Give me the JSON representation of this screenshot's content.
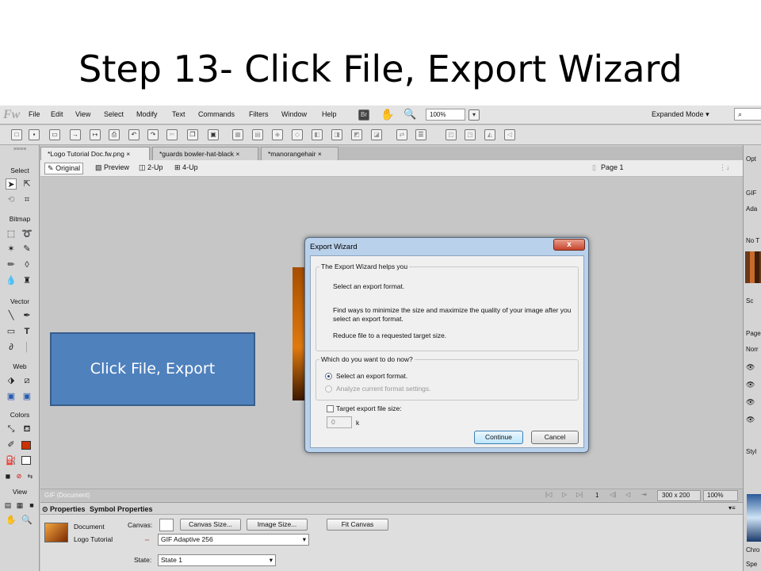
{
  "slide": {
    "title": "Step 13- Click File, Export Wizard"
  },
  "app": {
    "logo": "Fw",
    "menu": [
      "File",
      "Edit",
      "View",
      "Select",
      "Modify",
      "Text",
      "Commands",
      "Filters",
      "Window",
      "Help"
    ],
    "bridge_label": "Br",
    "zoom": "100%",
    "mode": "Expanded Mode",
    "mode_caret": "▾"
  },
  "toolbox": {
    "grip": "≡≡≡≡",
    "sections": [
      "Select",
      "Bitmap",
      "Vector",
      "Web",
      "Colors",
      "View"
    ]
  },
  "doc_tabs": [
    {
      "label": "*Logo Tutorial Doc.fw.png",
      "close": "×"
    },
    {
      "label": "*guards bowler-hat-black",
      "close": "×"
    },
    {
      "label": "*manorangehair",
      "close": "×"
    }
  ],
  "view_bar": {
    "original": "Original",
    "preview": "Preview",
    "two_up": "2-Up",
    "four_up": "4-Up",
    "page": "Page 1"
  },
  "status_bar": {
    "doc_type": "GIF (Document)",
    "frame": "1",
    "size": "300 x 200",
    "zoom": "100%"
  },
  "properties": {
    "tabs": [
      "Properties",
      "Symbol Properties"
    ],
    "doc_label": "Document",
    "doc_name": "Logo Tutorial",
    "canvas_label": "Canvas:",
    "canvas_size_btn": "Canvas Size...",
    "image_size_btn": "Image Size...",
    "fit_canvas_btn": "Fit Canvas",
    "format_value": "GIF Adaptive 256",
    "state_label": "State:",
    "state_value": "State 1"
  },
  "right_panel": {
    "labels": [
      "Opt",
      "GIF",
      "Ada",
      "No T",
      "Sc",
      "Page",
      "Norr",
      "Styl",
      "Chro",
      "Spe"
    ]
  },
  "dialog": {
    "title": "Export Wizard",
    "close": "x",
    "group1_title": "The Export Wizard helps you",
    "line1": "Select an export format.",
    "line2": "Find ways to minimize the size and maximize the quality of your image after you select an export format.",
    "line3": "Reduce file to a requested target size.",
    "group2_title": "Which do you want to do now?",
    "option1": "Select an export format.",
    "option2": "Analyze current format settings.",
    "target_label": "Target export file size:",
    "target_value": "0",
    "target_unit": "k",
    "continue_btn": "Continue",
    "cancel_btn": "Cancel"
  },
  "callout": {
    "text": "Click File, Export"
  },
  "colors": {
    "callout": "#4f81bd",
    "stroke": "#cc3300"
  }
}
